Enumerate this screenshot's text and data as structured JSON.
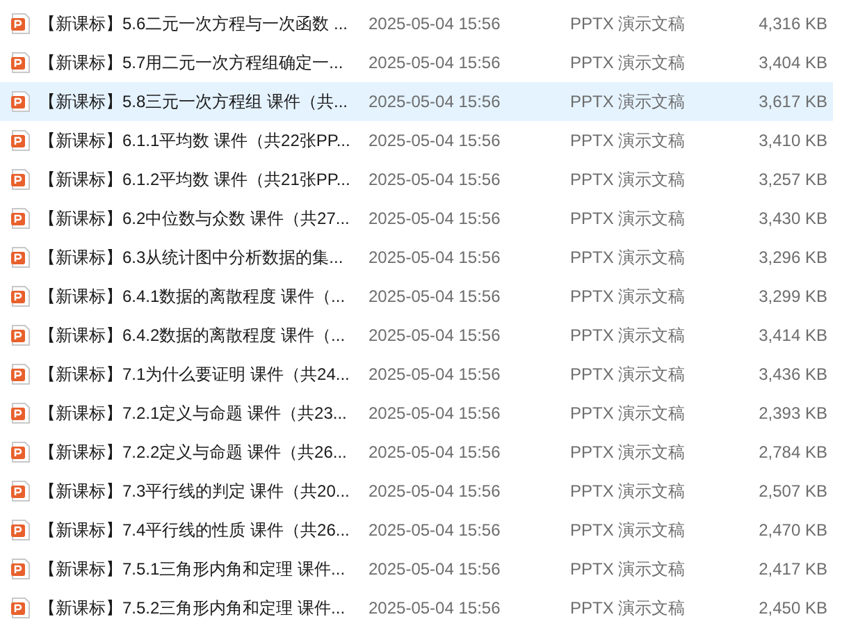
{
  "files": [
    {
      "name": "【新课标】5.6二元一次方程与一次函数 ...",
      "date": "2025-05-04 15:56",
      "type": "PPTX 演示文稿",
      "size": "4,316 KB",
      "selected": false
    },
    {
      "name": "【新课标】5.7用二元一次方程组确定一...",
      "date": "2025-05-04 15:56",
      "type": "PPTX 演示文稿",
      "size": "3,404 KB",
      "selected": false
    },
    {
      "name": "【新课标】5.8三元一次方程组 课件（共...",
      "date": "2025-05-04 15:56",
      "type": "PPTX 演示文稿",
      "size": "3,617 KB",
      "selected": true
    },
    {
      "name": "【新课标】6.1.1平均数 课件（共22张PP...",
      "date": "2025-05-04 15:56",
      "type": "PPTX 演示文稿",
      "size": "3,410 KB",
      "selected": false
    },
    {
      "name": "【新课标】6.1.2平均数 课件（共21张PP...",
      "date": "2025-05-04 15:56",
      "type": "PPTX 演示文稿",
      "size": "3,257 KB",
      "selected": false
    },
    {
      "name": "【新课标】6.2中位数与众数 课件（共27...",
      "date": "2025-05-04 15:56",
      "type": "PPTX 演示文稿",
      "size": "3,430 KB",
      "selected": false
    },
    {
      "name": "【新课标】6.3从统计图中分析数据的集...",
      "date": "2025-05-04 15:56",
      "type": "PPTX 演示文稿",
      "size": "3,296 KB",
      "selected": false
    },
    {
      "name": "【新课标】6.4.1数据的离散程度 课件（...",
      "date": "2025-05-04 15:56",
      "type": "PPTX 演示文稿",
      "size": "3,299 KB",
      "selected": false
    },
    {
      "name": "【新课标】6.4.2数据的离散程度 课件（...",
      "date": "2025-05-04 15:56",
      "type": "PPTX 演示文稿",
      "size": "3,414 KB",
      "selected": false
    },
    {
      "name": "【新课标】7.1为什么要证明 课件（共24...",
      "date": "2025-05-04 15:56",
      "type": "PPTX 演示文稿",
      "size": "3,436 KB",
      "selected": false
    },
    {
      "name": "【新课标】7.2.1定义与命题 课件（共23...",
      "date": "2025-05-04 15:56",
      "type": "PPTX 演示文稿",
      "size": "2,393 KB",
      "selected": false
    },
    {
      "name": "【新课标】7.2.2定义与命题 课件（共26...",
      "date": "2025-05-04 15:56",
      "type": "PPTX 演示文稿",
      "size": "2,784 KB",
      "selected": false
    },
    {
      "name": "【新课标】7.3平行线的判定 课件（共20...",
      "date": "2025-05-04 15:56",
      "type": "PPTX 演示文稿",
      "size": "2,507 KB",
      "selected": false
    },
    {
      "name": "【新课标】7.4平行线的性质 课件（共26...",
      "date": "2025-05-04 15:56",
      "type": "PPTX 演示文稿",
      "size": "2,470 KB",
      "selected": false
    },
    {
      "name": "【新课标】7.5.1三角形内角和定理 课件...",
      "date": "2025-05-04 15:56",
      "type": "PPTX 演示文稿",
      "size": "2,417 KB",
      "selected": false
    },
    {
      "name": "【新课标】7.5.2三角形内角和定理 课件...",
      "date": "2025-05-04 15:56",
      "type": "PPTX 演示文稿",
      "size": "2,450 KB",
      "selected": false
    }
  ]
}
